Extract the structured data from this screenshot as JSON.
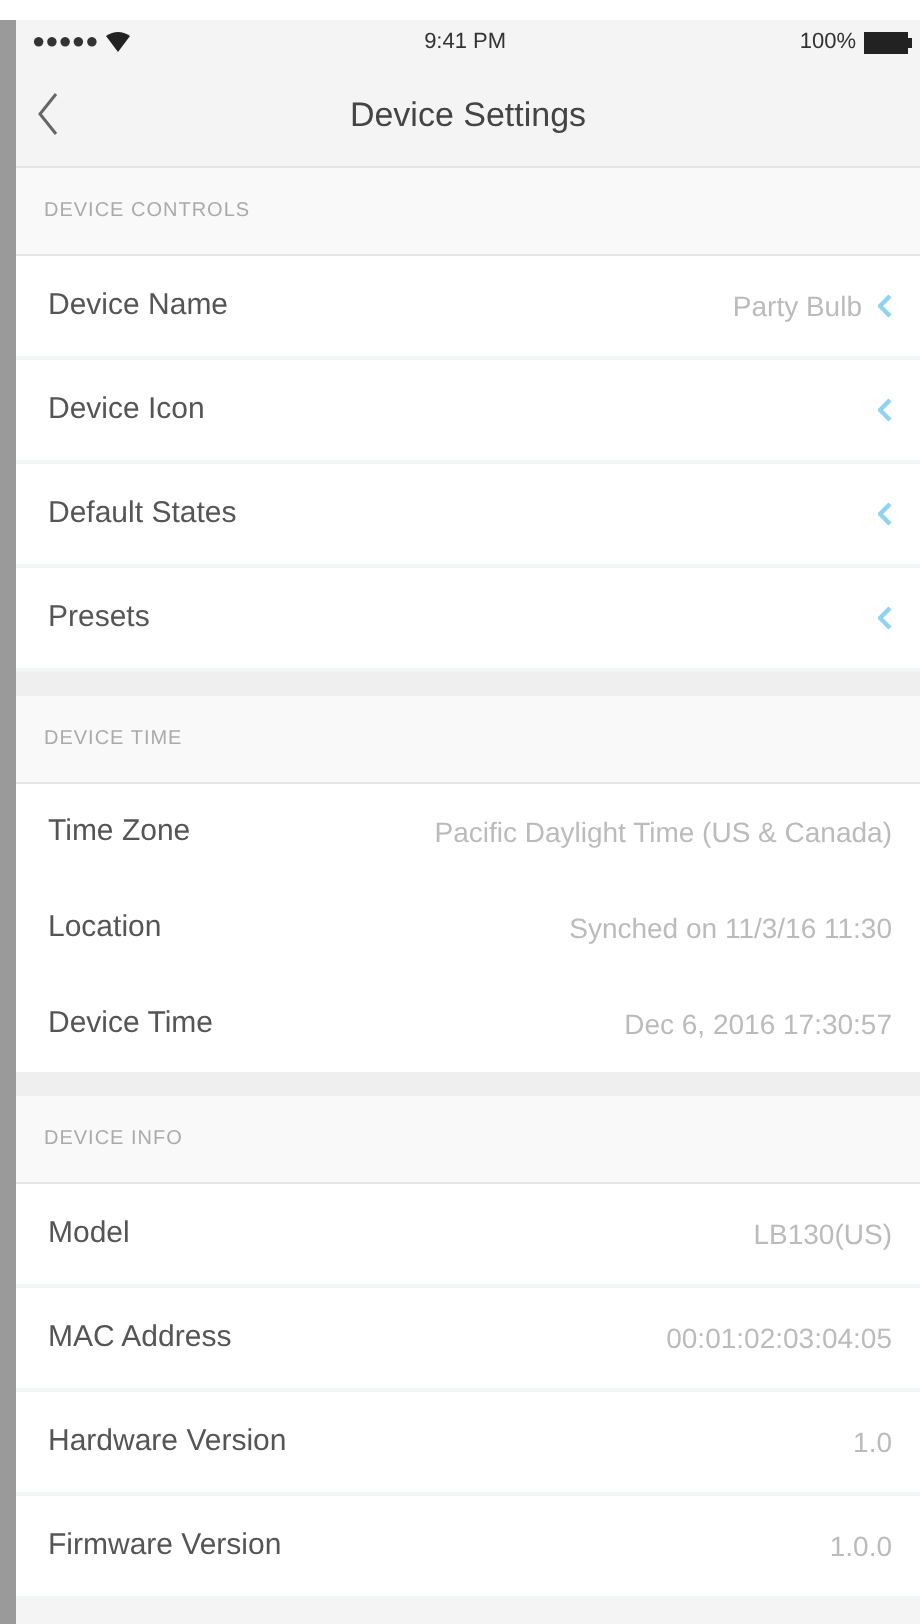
{
  "status_bar": {
    "carrier": "●●●●●",
    "time": "9:41 PM",
    "battery": "100%"
  },
  "nav": {
    "title": "Device Settings"
  },
  "sections": [
    {
      "title": "DEVICE CONTROLS",
      "rows": [
        {
          "kind": "link",
          "label": "Device Name",
          "value": "Party Bulb"
        },
        {
          "kind": "link",
          "label": "Device Icon"
        },
        {
          "kind": "link",
          "label": "Default States"
        },
        {
          "kind": "link",
          "label": "Presets"
        }
      ]
    },
    {
      "title": "DEVICE TIME",
      "rows": [
        {
          "kind": "info",
          "label": "Time Zone",
          "value": "Pacific Daylight Time (US & Canada)"
        },
        {
          "kind": "info",
          "label": "Location",
          "value": "Synched  on 11/3/16 11:30"
        },
        {
          "kind": "info",
          "label": "Device Time",
          "value": "Dec 6, 2016   17:30:57"
        }
      ]
    },
    {
      "title": "DEVICE INFO",
      "rows": [
        {
          "kind": "info",
          "label": "Model",
          "value": "LB130(US)"
        },
        {
          "kind": "info",
          "label": "MAC Address",
          "value": "00:01:02:03:04:05"
        },
        {
          "kind": "info",
          "label": "Hardware Version",
          "value": "1.0"
        },
        {
          "kind": "info",
          "label": "Firmware Version",
          "value": "1.0.0"
        }
      ]
    }
  ]
}
